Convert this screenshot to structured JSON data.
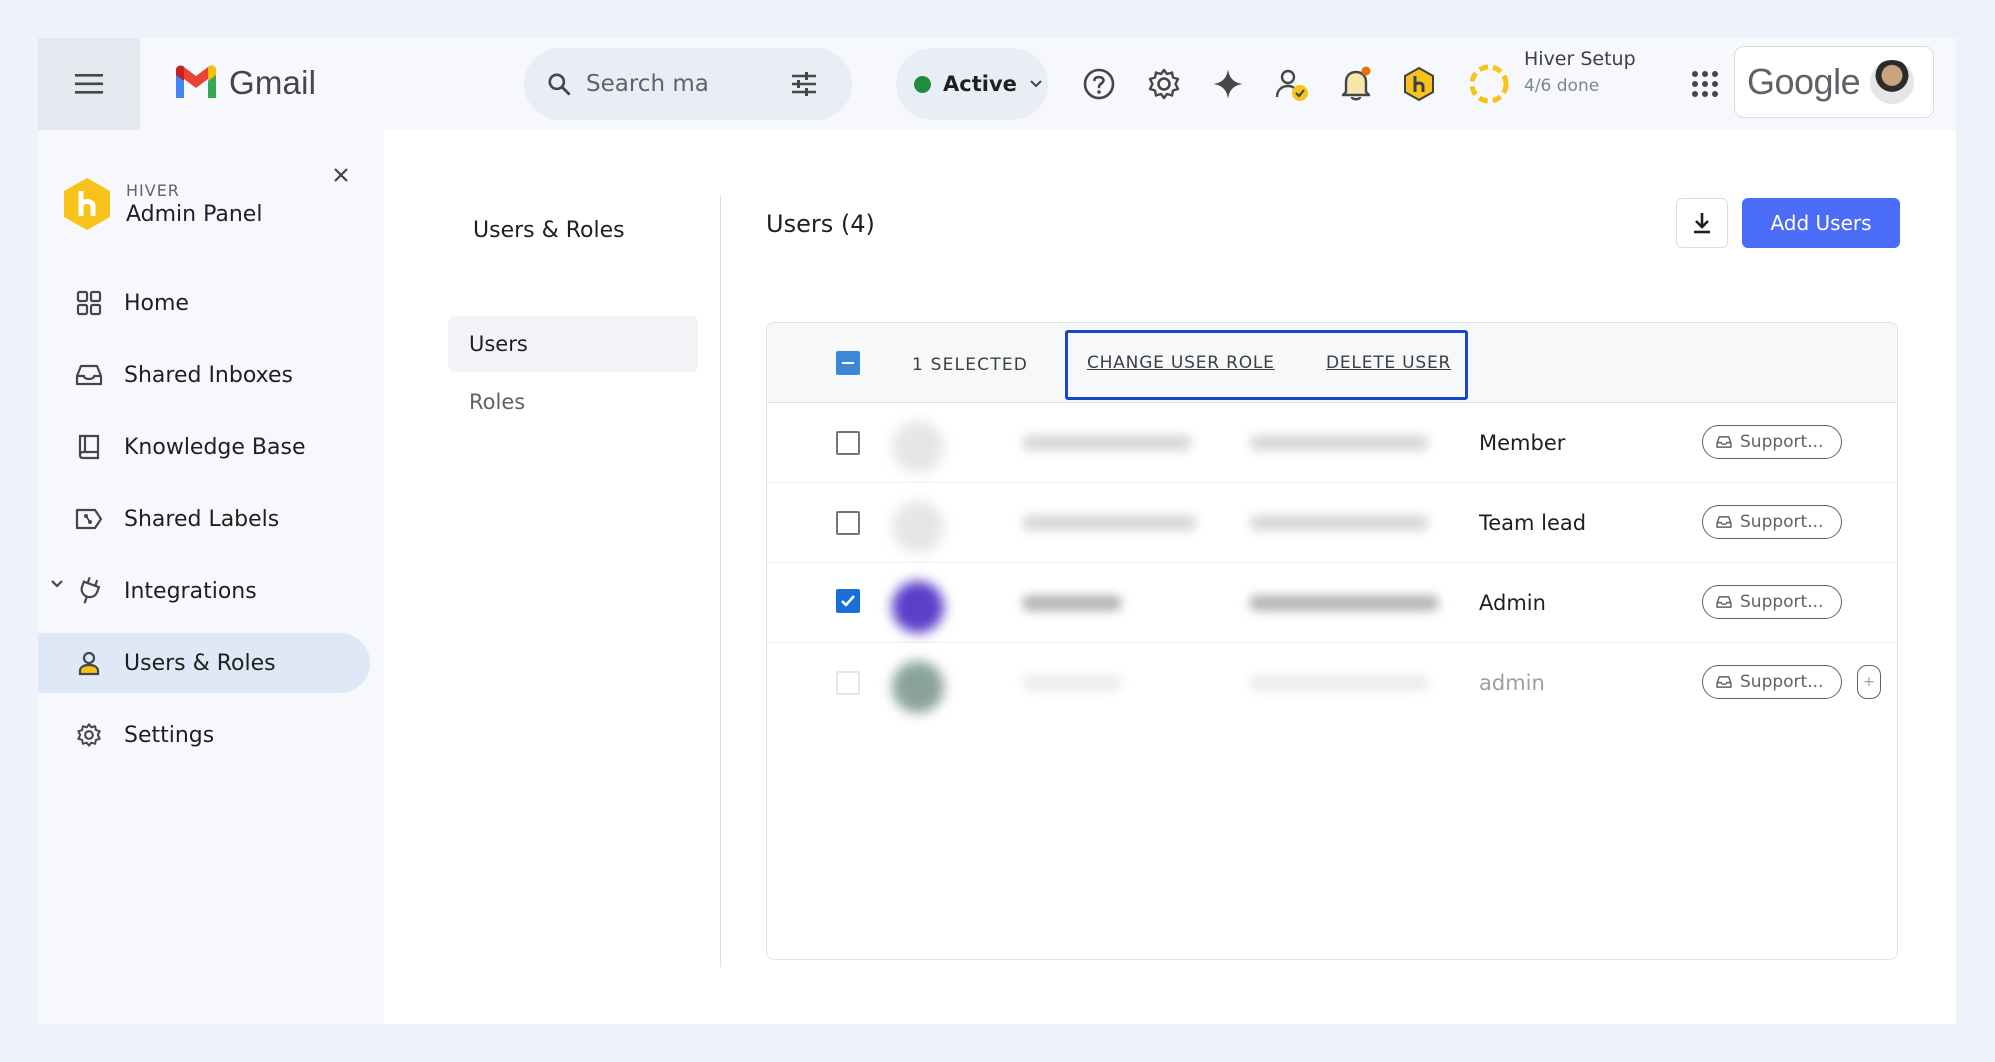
{
  "topbar": {
    "app_name": "Gmail",
    "search": {
      "placeholder": "Search ma"
    },
    "status": {
      "label": "Active",
      "color": "#1e8e3e"
    },
    "setup": {
      "title": "Hiver Setup",
      "progress": "4/6 done"
    },
    "account_brand": "Google"
  },
  "sidebar": {
    "brand_small": "HIVER",
    "brand_title": "Admin Panel",
    "items": [
      {
        "label": "Home",
        "icon": "grid-icon"
      },
      {
        "label": "Shared Inboxes",
        "icon": "inbox-icon"
      },
      {
        "label": "Knowledge Base",
        "icon": "book-icon"
      },
      {
        "label": "Shared Labels",
        "icon": "label-icon"
      },
      {
        "label": "Integrations",
        "icon": "plug-icon"
      },
      {
        "label": "Users & Roles",
        "icon": "person-icon",
        "active": true
      },
      {
        "label": "Settings",
        "icon": "gear-icon"
      }
    ]
  },
  "subnav": {
    "title": "Users & Roles",
    "items": [
      "Users",
      "Roles"
    ]
  },
  "users": {
    "title": "Users (4)",
    "add_button": "Add Users",
    "bulk": {
      "selected_text": "1 SELECTED",
      "change_role": "CHANGE USER ROLE",
      "delete_user": "DELETE USER"
    },
    "rows": [
      {
        "role": "Member",
        "team": "Support...",
        "checked": false
      },
      {
        "role": "Team lead",
        "team": "Support...",
        "checked": false
      },
      {
        "role": "Admin",
        "team": "Support...",
        "checked": true
      },
      {
        "role": "admin",
        "team": "Support...",
        "checked": false
      }
    ]
  },
  "colors": {
    "accent": "#4a6cf7",
    "highlight_border": "#1747c9",
    "hiver_yellow": "#f7c31a"
  }
}
